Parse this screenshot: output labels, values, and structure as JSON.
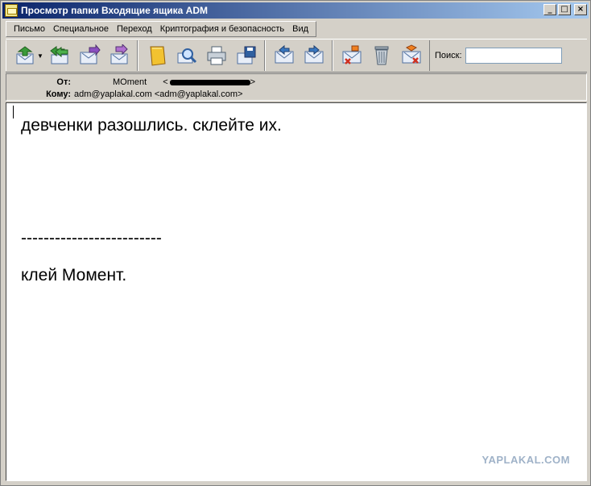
{
  "window": {
    "title": "Просмотр папки Входящие ящика ADM",
    "controls": {
      "minimize": "_",
      "maximize": "□",
      "close": "×"
    }
  },
  "menu": {
    "items": [
      {
        "label": "Письмо"
      },
      {
        "label": "Специальное"
      },
      {
        "label": "Переход"
      },
      {
        "label": "Криптография и безопасность"
      },
      {
        "label": "Вид"
      }
    ]
  },
  "toolbar": {
    "buttons": [
      {
        "icon": "reply-icon",
        "color": "#3a9a3a"
      },
      {
        "icon": "reply-all-icon",
        "color": "#3a9a3a"
      },
      {
        "icon": "forward-icon",
        "color": "#8a4fc0"
      },
      {
        "icon": "redirect-icon",
        "color": "#8a4fc0"
      },
      {
        "icon": "address-book-icon",
        "color": "#e0a800"
      },
      {
        "icon": "find-icon",
        "color": "#3060a0"
      },
      {
        "icon": "print-icon",
        "color": "#506070"
      },
      {
        "icon": "save-icon",
        "color": "#3060a0"
      },
      {
        "icon": "previous-message-icon",
        "color": "#3a78c0"
      },
      {
        "icon": "next-message-icon",
        "color": "#3a78c0"
      },
      {
        "icon": "delete-message-icon",
        "color": "#d03020"
      },
      {
        "icon": "trash-icon",
        "color": "#607080"
      },
      {
        "icon": "junk-icon",
        "color": "#d03020"
      }
    ],
    "search_label": "Поиск:",
    "search_value": ""
  },
  "headers": {
    "from_label": "От:",
    "from_name": "MOment",
    "from_addr_open": "<",
    "from_addr_close": ">",
    "to_label": "Кому:",
    "to_value": "adm@yaplakal.com <adm@yaplakal.com>"
  },
  "message": {
    "lines": [
      "девченки разошлись. склейте их.",
      "-------------------------",
      "клей Момент."
    ]
  },
  "watermark": "YAPLAKAL.COM"
}
